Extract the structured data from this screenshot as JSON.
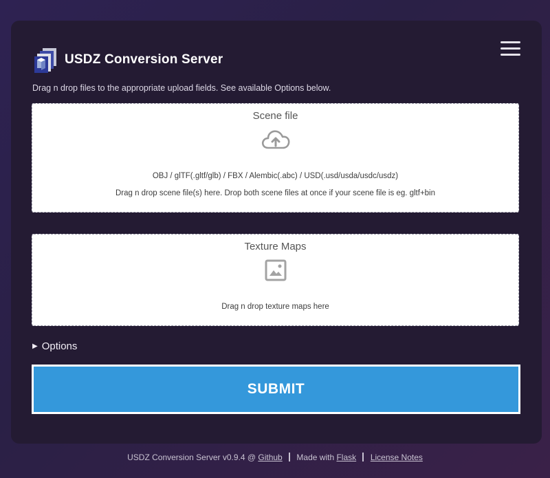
{
  "header": {
    "title": "USDZ Conversion Server",
    "menu_icon": "hamburger-menu-icon"
  },
  "intro_text": "Drag n drop files to the appropriate upload fields. See available Options below.",
  "scene_dropzone": {
    "title": "Scene file",
    "icon": "cloud-upload-icon",
    "formats": "OBJ / glTF(.gltf/glb) / FBX / Alembic(.abc) / USD(.usd/usda/usdc/usdz)",
    "hint": "Drag n drop scene file(s) here. Drop both scene files at once if your scene file is eg. gltf+bin"
  },
  "texture_dropzone": {
    "title": "Texture Maps",
    "icon": "image-icon",
    "hint": "Drag n drop texture maps here"
  },
  "options": {
    "label": "Options",
    "expanded": false
  },
  "submit": {
    "label": "SUBMIT"
  },
  "footer": {
    "version_text": "USDZ Conversion Server v0.9.4 @",
    "github_link": "Github",
    "made_with_text": "Made with",
    "flask_link": "Flask",
    "license_link": "License Notes"
  },
  "colors": {
    "accent": "#3498db",
    "card_bg": "#241b33"
  }
}
